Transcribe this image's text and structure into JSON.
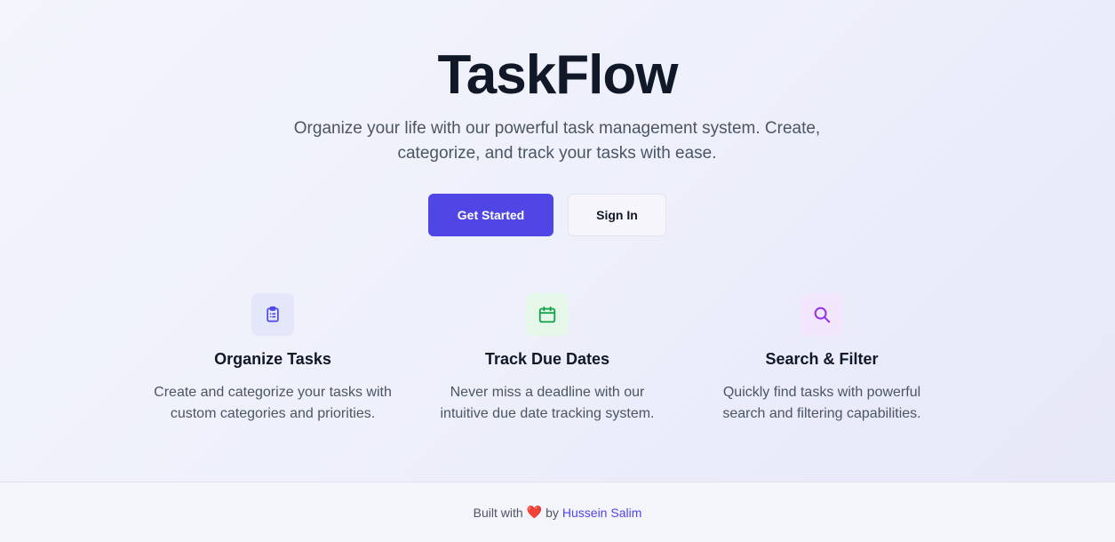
{
  "hero": {
    "title": "TaskFlow",
    "subtitle": "Organize your life with our powerful task management system. Create, categorize, and track your tasks with ease.",
    "primary_button": "Get Started",
    "secondary_button": "Sign In"
  },
  "features": [
    {
      "icon": "clipboard-list-icon",
      "icon_color": "#4f46e5",
      "icon_bg": "#e4e6f9",
      "title": "Organize Tasks",
      "description": "Create and categorize your tasks with custom categories and priorities."
    },
    {
      "icon": "calendar-icon",
      "icon_color": "#16a34a",
      "icon_bg": "#e4f7e8",
      "title": "Track Due Dates",
      "description": "Never miss a deadline with our intuitive due date tracking system."
    },
    {
      "icon": "search-icon",
      "icon_color": "#9333ea",
      "icon_bg": "#f1e6fb",
      "title": "Search & Filter",
      "description": "Quickly find tasks with powerful search and filtering capabilities."
    }
  ],
  "footer": {
    "prefix": "Built with",
    "heart": "❤️",
    "by": "by",
    "author": "Hussein Salim"
  },
  "colors": {
    "accent": "#4f46e5",
    "heading": "#111827",
    "body_text": "#4b5563"
  }
}
